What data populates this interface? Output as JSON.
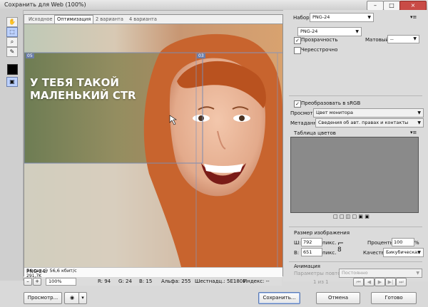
{
  "window": {
    "title": "Сохранить для Web (100%)"
  },
  "tabs": [
    "Исходное",
    "Оптимизация",
    "2 варианта",
    "4 варианта"
  ],
  "image": {
    "headline_line1": "У ТЕБЯ ТАКОЙ",
    "headline_line2": "МАЛЕНЬКИЙ CTR",
    "slice_labels": [
      "05",
      "03"
    ]
  },
  "info": {
    "format": "PNG-24",
    "size": "291,7K",
    "time": "54 сек @ 56,6 кбит/с"
  },
  "status": {
    "zoom": "100%",
    "r": "R: 94",
    "g": "G: 24",
    "b": "B: 15",
    "alpha": "Альфа: 255",
    "hex": "Шестнадц.: 5E180F",
    "index": "Индекс: --"
  },
  "bottom_buttons": {
    "preview": "Просмотр...",
    "save": "Сохранить...",
    "cancel": "Отмена",
    "done": "Готово"
  },
  "right_panel": {
    "preset_label": "Набор:",
    "preset_value": "PNG-24",
    "format_value": "PNG-24",
    "transparency_label": "Прозрачность",
    "matte_label": "Матовый:",
    "matte_value": "--",
    "interlaced_label": "Чересстрочно",
    "convert_srgb_label": "Преобразовать в sRGB",
    "preview_label": "Просмотр:",
    "preview_value": "Цвет монитора",
    "metadata_label": "Метаданные:",
    "metadata_value": "Сведения об авт. правах и контакты",
    "color_table_label": "Таблица цветов",
    "image_size_label": "Размер изображения",
    "width_label": "Ш:",
    "width_value": "792",
    "height_label": "В:",
    "height_value": "651",
    "unit_label": "пикс.",
    "percent_label": "Проценты:",
    "percent_value": "100",
    "percent_sign": "%",
    "quality_label": "Качество:",
    "quality_value": "Бикубическая",
    "animation_label": "Анимация",
    "loop_label": "Параметры повторов:",
    "loop_value": "Постоянно",
    "frame_counter": "1 из 1"
  },
  "colors": {
    "selection": "#6b7da8",
    "color_table": "#8a8a8a"
  }
}
